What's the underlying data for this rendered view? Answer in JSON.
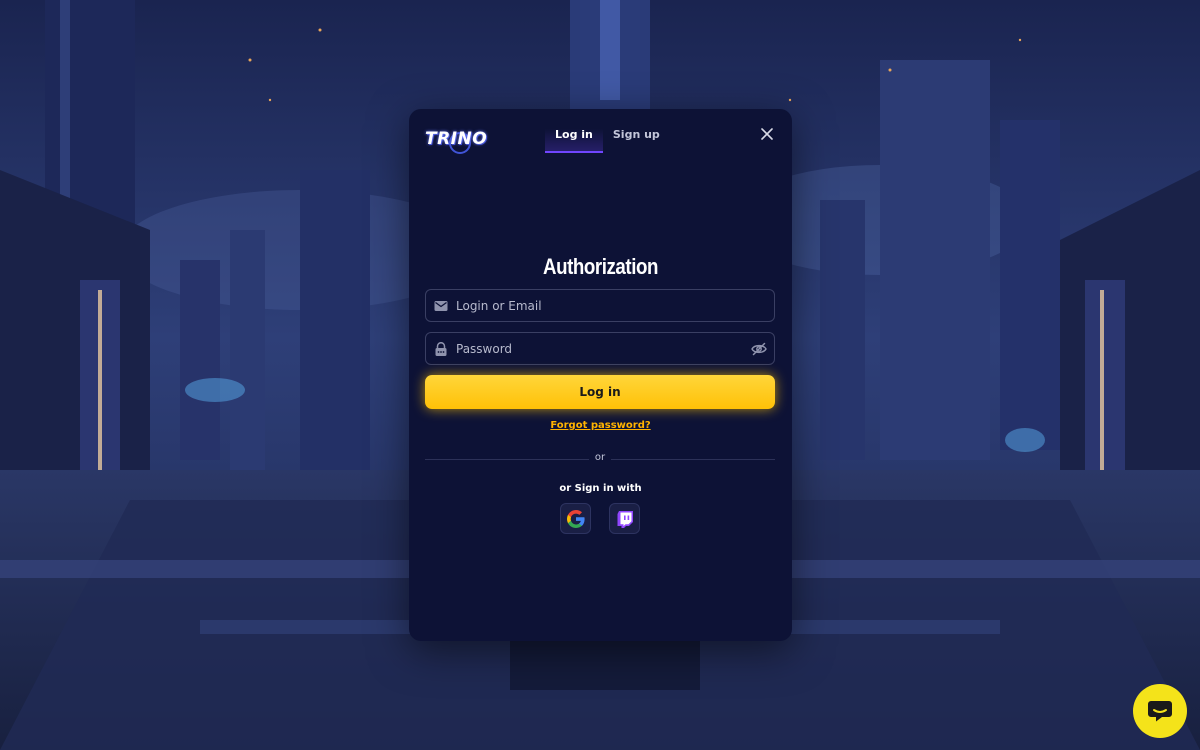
{
  "brand": {
    "logo_text": "TRINO"
  },
  "tabs": [
    {
      "label": "Log in",
      "active": true
    },
    {
      "label": "Sign up",
      "active": false
    }
  ],
  "auth": {
    "title": "Authorization",
    "login_placeholder": "Login or Email",
    "login_value": "",
    "password_placeholder": "Password",
    "password_value": "",
    "submit_label": "Log in",
    "forgot_label": "Forgot password?",
    "divider_label": "or",
    "social_label": "or Sign in with",
    "social_providers": [
      "google-icon",
      "twitch-icon"
    ]
  },
  "colors": {
    "modal_bg": "#0d1236",
    "accent": "#ffc107",
    "tab_underline": "#7045ff",
    "chat_bg": "#f4e31a"
  }
}
